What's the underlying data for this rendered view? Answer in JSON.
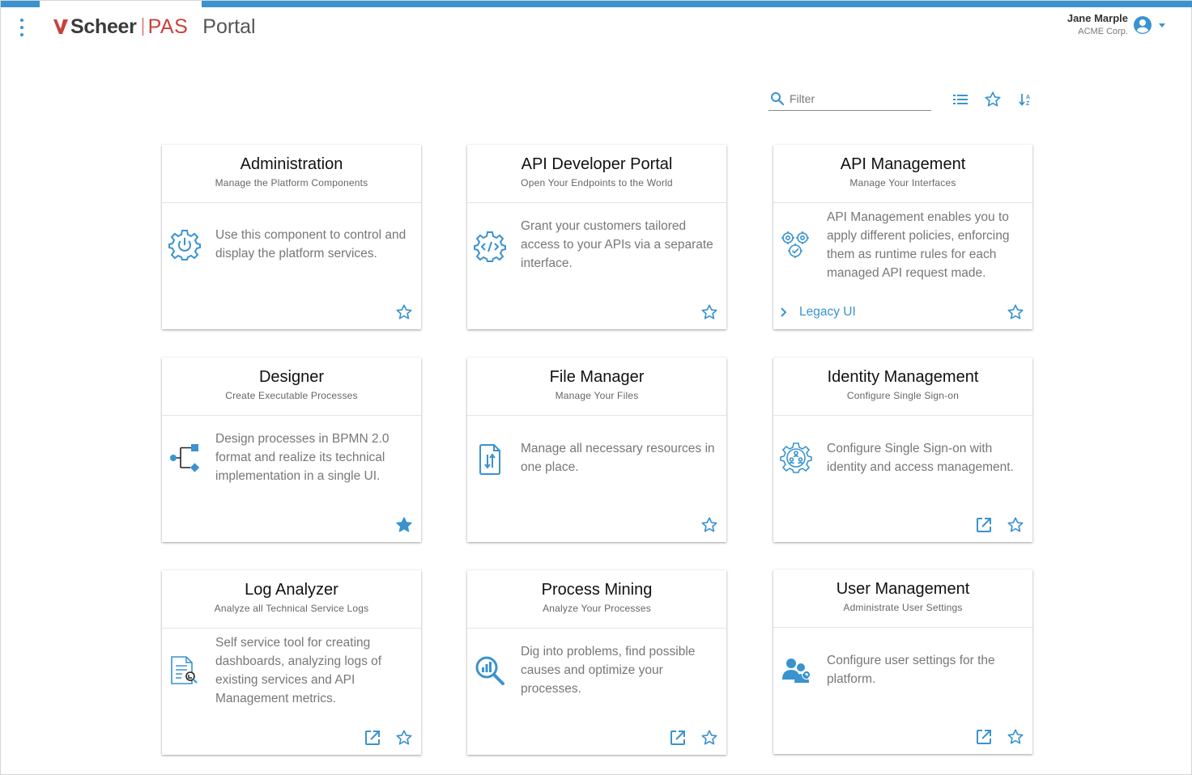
{
  "header": {
    "logo_brand": "Scheer",
    "logo_product": "PAS",
    "app_name": "Portal",
    "user_name": "Jane Marple",
    "user_company": "ACME Corp."
  },
  "toolbar": {
    "filter_placeholder": "Filter",
    "filter_value": ""
  },
  "colors": {
    "accent": "#3a93cf",
    "brand_red": "#c9423a"
  },
  "cards": [
    {
      "title": "Administration",
      "subtitle": "Manage the Platform Components",
      "description": "Use this component to control and display the platform services.",
      "icon": "gear-power-icon",
      "favorite": false
    },
    {
      "title": "API Developer Portal",
      "subtitle": "Open Your Endpoints to the World",
      "description": "Grant your customers tailored access to your APIs via a separate interface.",
      "icon": "gear-code-icon",
      "favorite": false
    },
    {
      "title": "API Management",
      "subtitle": "Manage Your Interfaces",
      "description": "API Management enables you to apply different policies, enforcing them as runtime rules for each managed API request made.",
      "icon": "gears-check-icon",
      "favorite": false,
      "link_label": "Legacy UI"
    },
    {
      "title": "Designer",
      "subtitle": "Create Executable Processes",
      "description": "Design processes in BPMN 2.0 format and realize its technical implementation in a single UI.",
      "icon": "process-flow-icon",
      "favorite": true
    },
    {
      "title": "File Manager",
      "subtitle": "Manage Your Files",
      "description": "Manage all necessary resources in one place.",
      "icon": "file-transfer-icon",
      "favorite": false
    },
    {
      "title": "Identity Management",
      "subtitle": "Configure Single Sign-on",
      "description": "Configure Single Sign-on with identity and access management.",
      "icon": "gear-users-icon",
      "favorite": false,
      "external": true
    },
    {
      "title": "Log Analyzer",
      "subtitle": "Analyze all Technical Service Logs",
      "description": "Self service tool for creating dashboards, analyzing logs of existing services and API Management metrics.",
      "icon": "document-search-icon",
      "favorite": false,
      "external": true
    },
    {
      "title": "Process Mining",
      "subtitle": "Analyze Your Processes",
      "description": "Dig into problems, find possible causes and optimize your processes.",
      "icon": "magnifier-chart-icon",
      "favorite": false,
      "external": true
    },
    {
      "title": "User Management",
      "subtitle": "Administrate User Settings",
      "description": "Configure user settings for the platform.",
      "icon": "users-gear-icon",
      "favorite": false,
      "external": true
    }
  ]
}
